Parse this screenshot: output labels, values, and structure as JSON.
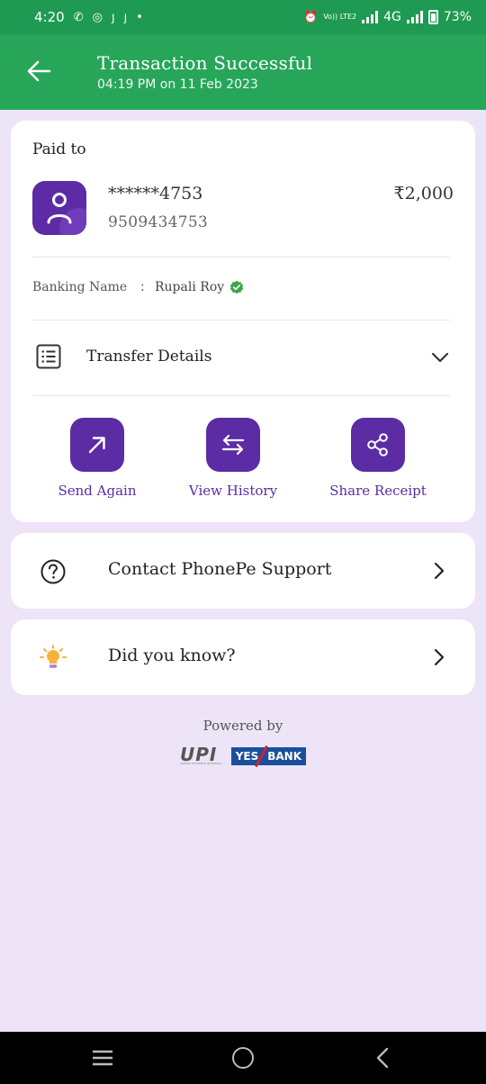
{
  "status_bar": {
    "time": "4:20",
    "indicators": [
      "phone-icon",
      "instagram-icon",
      "j-icon",
      "j-icon",
      "dot-icon"
    ],
    "volte": "Vo)) LTE2",
    "network": "4G",
    "battery": "73%"
  },
  "header": {
    "title": "Transaction Successful",
    "subtitle": "04:19 PM on 11 Feb 2023"
  },
  "payment": {
    "paid_to_label": "Paid to",
    "account_masked": "******4753",
    "phone": "9509434753",
    "amount": "₹2,000",
    "banking_name_label": "Banking Name",
    "banking_name_sep": ":",
    "banking_name": "Rupali Roy",
    "transfer_details_label": "Transfer Details"
  },
  "actions": [
    {
      "label": "Send Again",
      "icon": "arrow-up-right-icon"
    },
    {
      "label": "View History",
      "icon": "swap-arrows-icon"
    },
    {
      "label": "Share Receipt",
      "icon": "share-icon"
    }
  ],
  "support": {
    "label": "Contact PhonePe Support",
    "icon": "help-circle-icon"
  },
  "did_you_know": {
    "label": "Did you know?",
    "icon": "lightbulb-icon"
  },
  "footer": {
    "powered_by": "Powered by",
    "upi": "UPI",
    "upi_tagline": "UNIFIED PAYMENTS INTERFACE",
    "bank_yes": "YES",
    "bank_bank": "BANK"
  },
  "colors": {
    "status_bar": "#1f9a52",
    "header": "#27a65a",
    "brand_purple": "#5b2ca4",
    "background": "#ede4f7",
    "verified_green": "#3ea64a"
  }
}
